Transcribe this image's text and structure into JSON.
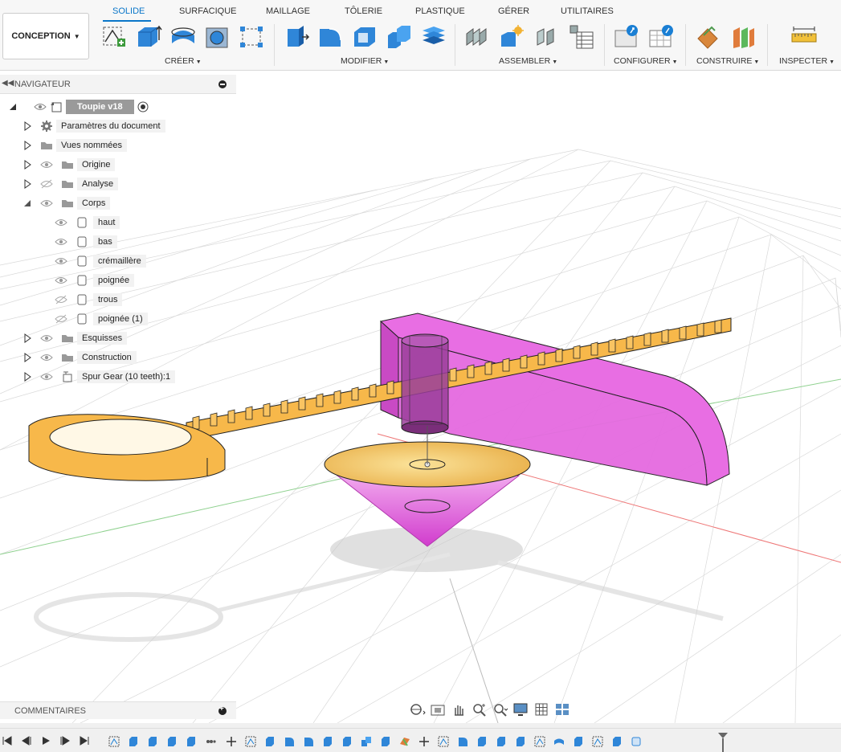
{
  "workspace": {
    "label": "CONCEPTION"
  },
  "tabs": [
    {
      "label": "SOLIDE",
      "active": true
    },
    {
      "label": "SURFACIQUE"
    },
    {
      "label": "MAILLAGE"
    },
    {
      "label": "TÔLERIE"
    },
    {
      "label": "PLASTIQUE"
    },
    {
      "label": "GÉRER"
    },
    {
      "label": "UTILITAIRES"
    }
  ],
  "groups": [
    {
      "label": "CRÉER"
    },
    {
      "label": "MODIFIER"
    },
    {
      "label": "ASSEMBLER"
    },
    {
      "label": "CONFIGURER"
    },
    {
      "label": "CONSTRUIRE"
    },
    {
      "label": "INSPECTER"
    }
  ],
  "navigator": {
    "title": "NAVIGATEUR",
    "root": "Toupie v18",
    "items": [
      {
        "label": "Paramètres du document"
      },
      {
        "label": "Vues nommées"
      },
      {
        "label": "Origine"
      },
      {
        "label": "Analyse"
      },
      {
        "label": "Corps"
      },
      {
        "label": "haut"
      },
      {
        "label": "bas"
      },
      {
        "label": "crémaillère"
      },
      {
        "label": "poignée"
      },
      {
        "label": "trous"
      },
      {
        "label": "poignée (1)"
      },
      {
        "label": "Esquisses"
      },
      {
        "label": "Construction"
      },
      {
        "label": "Spur Gear (10 teeth):1"
      }
    ]
  },
  "comments": {
    "title": "COMMENTAIRES"
  },
  "colors": {
    "accent": "#0a76c9",
    "orange_body": "#f7b84a",
    "magenta_body": "#e85ce0"
  }
}
